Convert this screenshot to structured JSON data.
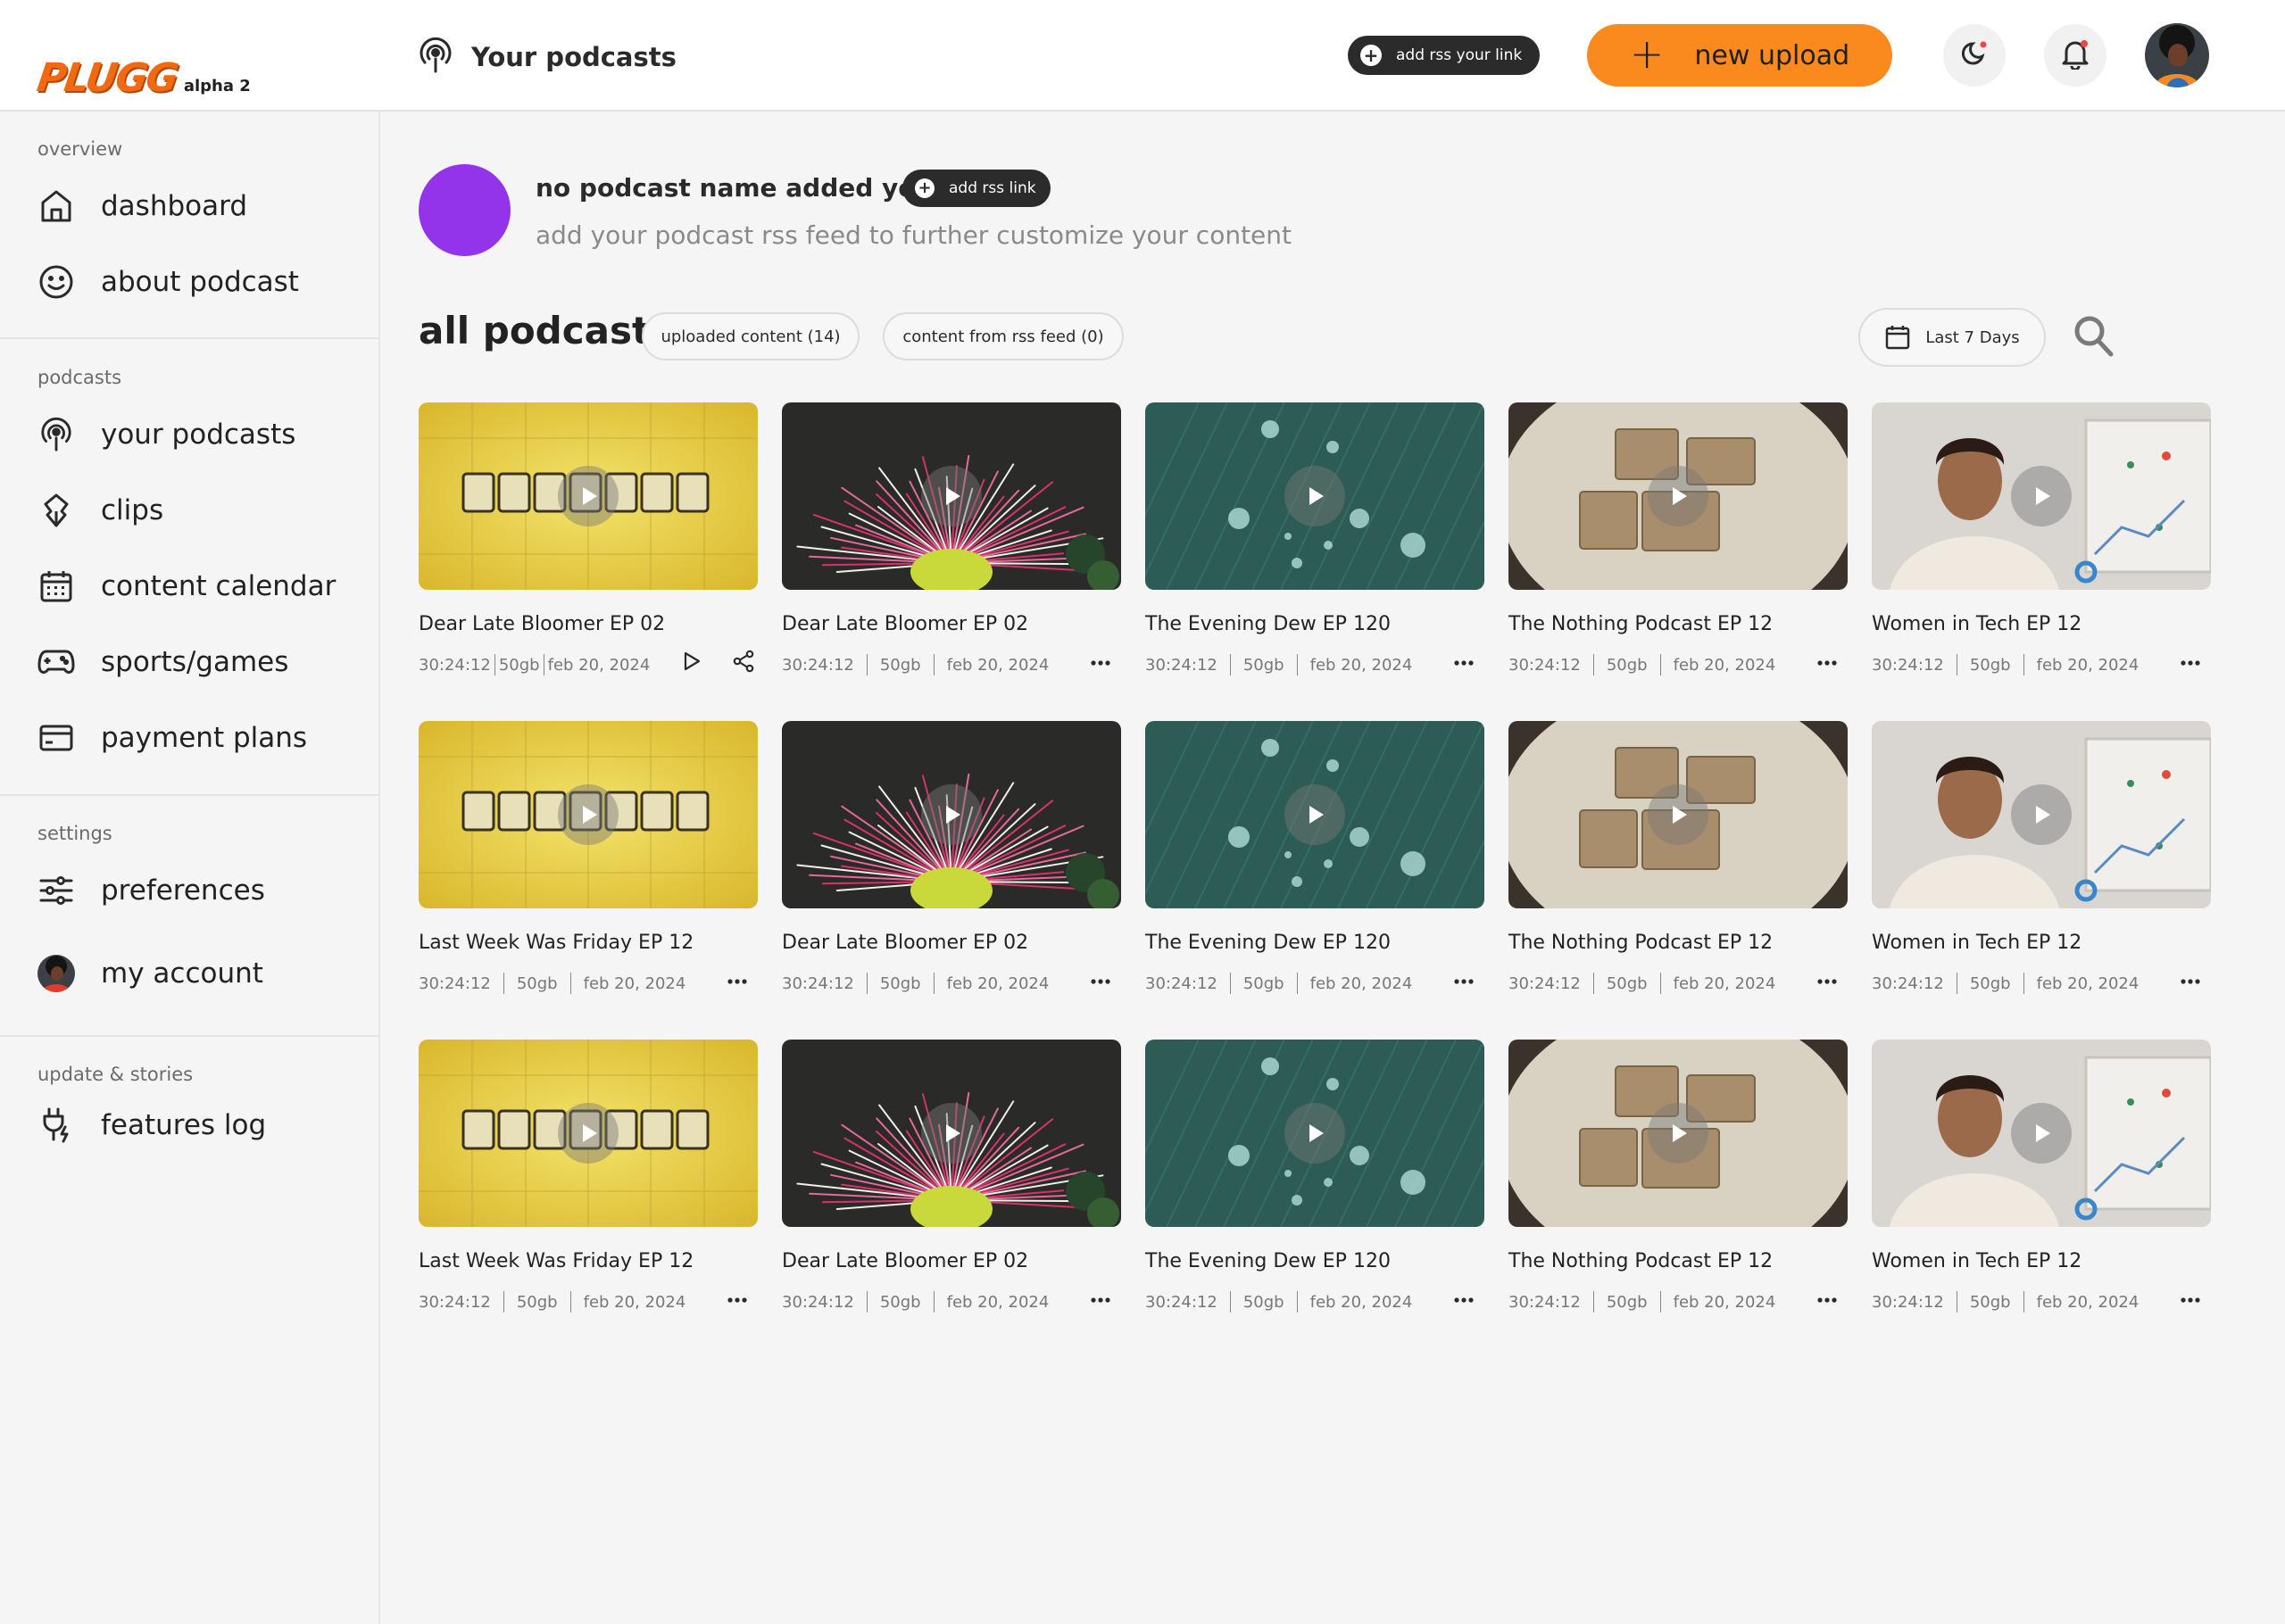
{
  "brand": {
    "logo_text": "PLUGG",
    "tag": "alpha 2",
    "accent": "#fb8a1e"
  },
  "header": {
    "title": "Your podcasts",
    "rss_button": "add rss your link",
    "new_upload": "new upload",
    "icons": [
      "podcast-icon",
      "moon-icon",
      "bell-icon"
    ]
  },
  "sidebar": {
    "sections": [
      {
        "label": "overview",
        "items": [
          {
            "label": "dashboard",
            "icon": "home-icon"
          },
          {
            "label": "about podcast",
            "icon": "smile-icon"
          }
        ]
      },
      {
        "label": "podcasts",
        "items": [
          {
            "label": "your podcasts",
            "icon": "podcast-icon"
          },
          {
            "label": "clips",
            "icon": "clip-icon"
          },
          {
            "label": "content calendar",
            "icon": "calendar-icon"
          },
          {
            "label": "sports/games",
            "icon": "gamepad-icon"
          },
          {
            "label": "payment plans",
            "icon": "card-icon"
          }
        ]
      },
      {
        "label": "settings",
        "items": [
          {
            "label": "preferences",
            "icon": "sliders-icon"
          },
          {
            "label": "my account",
            "icon": "avatar"
          }
        ]
      },
      {
        "label": "update & stories",
        "items": [
          {
            "label": "features log",
            "icon": "plug-icon"
          }
        ]
      }
    ]
  },
  "podcast": {
    "name": "no podcast name added yet",
    "rss_button": "add rss link",
    "subtitle": "add your podcast rss feed to further customize your content",
    "avatar_color": "#9333ea"
  },
  "content": {
    "title": "all podcast",
    "filters": [
      "uploaded content (14)",
      "content from rss feed (0)"
    ],
    "date_filter": "Last 7 Days",
    "rows": [
      [
        {
          "title": "Dear Late Bloomer EP 02",
          "duration": "30:24:12",
          "size": "50gb",
          "date": "feb 20, 2024",
          "thumb": "notebook"
        },
        {
          "title": "Dear Late Bloomer EP 02",
          "duration": "30:24:12",
          "size": "50gb",
          "date": "feb 20, 2024",
          "thumb": "flower"
        },
        {
          "title": "The Evening Dew EP 120",
          "duration": "30:24:12",
          "size": "50gb",
          "date": "feb 20, 2024",
          "thumb": "leaf"
        },
        {
          "title": "The Nothing Podcast EP 12",
          "duration": "30:24:12",
          "size": "50gb",
          "date": "feb 20, 2024",
          "thumb": "notes"
        },
        {
          "title": "Women in Tech EP 12",
          "duration": "30:24:12",
          "size": "50gb",
          "date": "feb 20, 2024",
          "thumb": "presenter"
        }
      ],
      [
        {
          "title": "Last Week Was Friday EP 12",
          "duration": "30:24:12",
          "size": "50gb",
          "date": "feb 20, 2024",
          "thumb": "notebook"
        },
        {
          "title": "Dear Late Bloomer EP 02",
          "duration": "30:24:12",
          "size": "50gb",
          "date": "feb 20, 2024",
          "thumb": "flower"
        },
        {
          "title": "The Evening Dew EP 120",
          "duration": "30:24:12",
          "size": "50gb",
          "date": "feb 20, 2024",
          "thumb": "leaf"
        },
        {
          "title": "The Nothing Podcast EP 12",
          "duration": "30:24:12",
          "size": "50gb",
          "date": "feb 20, 2024",
          "thumb": "notes"
        },
        {
          "title": "Women in Tech EP 12",
          "duration": "30:24:12",
          "size": "50gb",
          "date": "feb 20, 2024",
          "thumb": "presenter"
        }
      ],
      [
        {
          "title": "Last Week Was Friday EP 12",
          "duration": "30:24:12",
          "size": "50gb",
          "date": "feb 20, 2024",
          "thumb": "notebook"
        },
        {
          "title": "Dear Late Bloomer EP 02",
          "duration": "30:24:12",
          "size": "50gb",
          "date": "feb 20, 2024",
          "thumb": "flower"
        },
        {
          "title": "The Evening Dew EP 120",
          "duration": "30:24:12",
          "size": "50gb",
          "date": "feb 20, 2024",
          "thumb": "leaf"
        },
        {
          "title": "The Nothing Podcast EP 12",
          "duration": "30:24:12",
          "size": "50gb",
          "date": "feb 20, 2024",
          "thumb": "notes"
        },
        {
          "title": "Women in Tech EP 12",
          "duration": "30:24:12",
          "size": "50gb",
          "date": "feb 20, 2024",
          "thumb": "presenter"
        }
      ]
    ]
  }
}
